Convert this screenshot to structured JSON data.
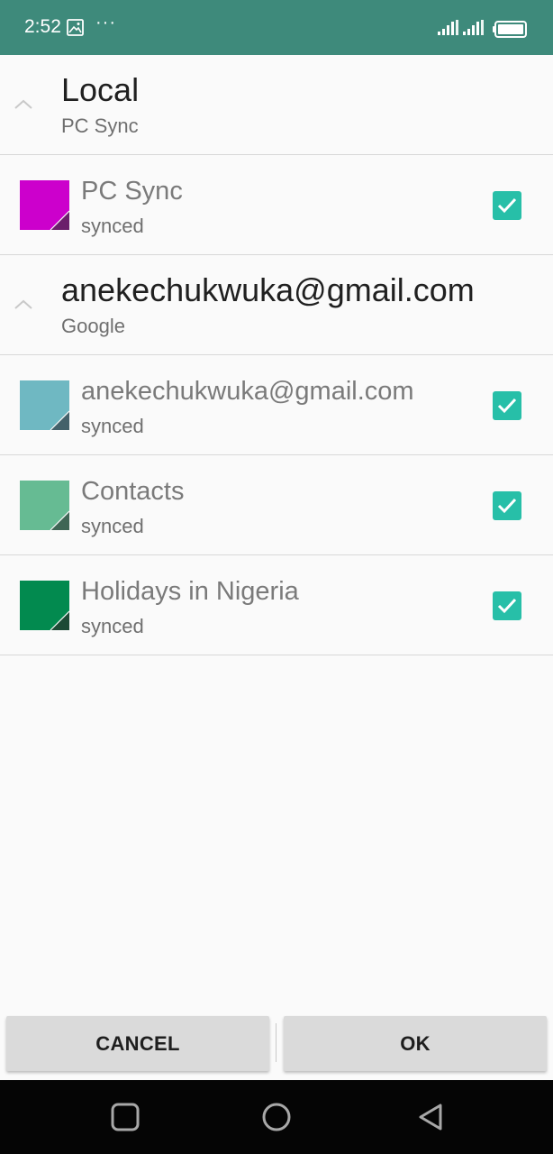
{
  "status_bar": {
    "time": "2:52",
    "more": "···",
    "icons": [
      "gallery-icon",
      "signal-icon",
      "signal-icon",
      "battery-icon"
    ],
    "background": "#3e8a7b"
  },
  "groups": [
    {
      "title": "Local",
      "subtitle": "PC Sync",
      "calendars": [
        {
          "name": "PC Sync",
          "status": "synced",
          "color": "#cc00cc",
          "shade": "#6b1f6b",
          "checked": true
        }
      ]
    },
    {
      "title": "anekechukwuka@gmail.com",
      "subtitle": "Google",
      "calendars": [
        {
          "name": "anekechukwuka@gmail.com",
          "status": "synced",
          "color": "#6fb8c2",
          "shade": "#44616a",
          "checked": true
        },
        {
          "name": "Contacts",
          "status": "synced",
          "color": "#66bb93",
          "shade": "#3f6655",
          "checked": true
        },
        {
          "name": "Holidays in Nigeria",
          "status": "synced",
          "color": "#028a4f",
          "shade": "#1d4a35",
          "checked": true
        }
      ]
    }
  ],
  "buttons": {
    "cancel": "CANCEL",
    "ok": "OK"
  },
  "nav": [
    "recent-apps-icon",
    "home-icon",
    "back-icon"
  ],
  "accent_color": "#27bfa8"
}
